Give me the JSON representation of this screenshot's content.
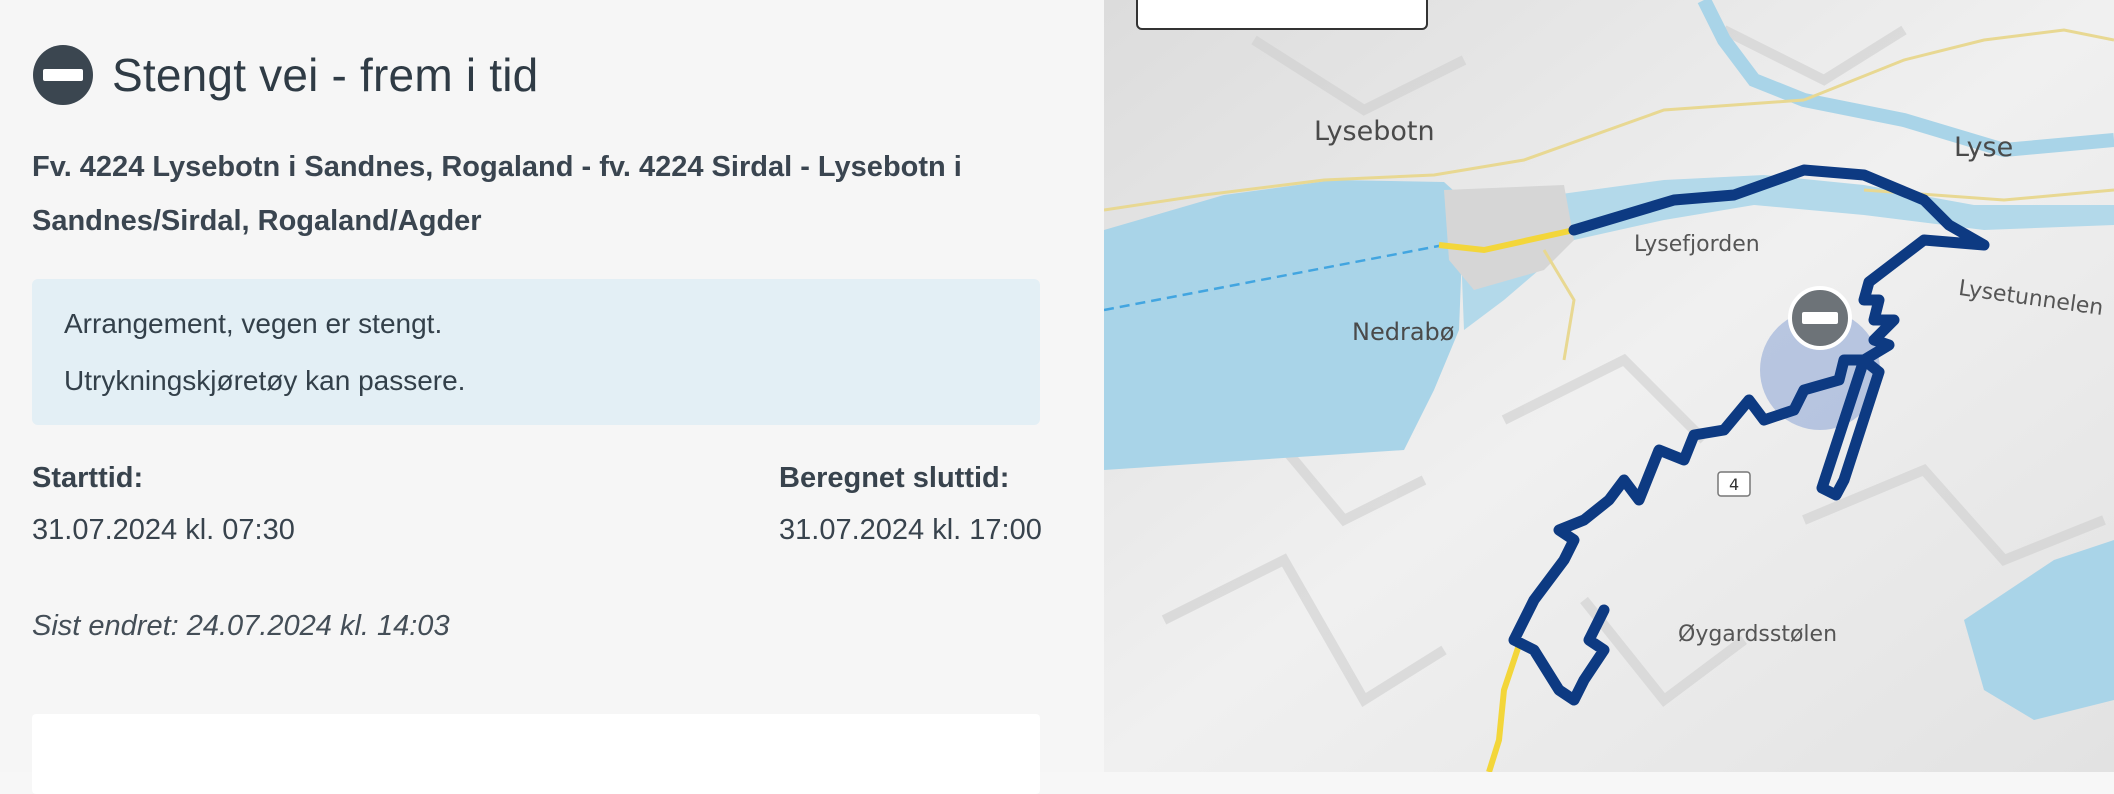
{
  "panel": {
    "title": "Stengt vei - frem i tid",
    "title_icon": "no-entry-icon",
    "road_line1": "Fv. 4224 Lysebotn i Sandnes, Rogaland - fv. 4224 Sirdal - Lysebotn i",
    "road_line2": "Sandnes/Sirdal, Rogaland/Agder",
    "info": {
      "line1": "Arrangement, vegen er stengt.",
      "line2": "Utrykningskjøretøy kan passere."
    },
    "start_label": "Starttid:",
    "start_value": "31.07.2024 kl. 07:30",
    "end_label": "Beregnet sluttid:",
    "end_value": "31.07.2024 kl. 17:00",
    "changed": "Sist endret: 24.07.2024 kl. 14:03"
  },
  "map": {
    "labels": {
      "lysebotn": "Lysebotn",
      "lyse": "Lyse",
      "lysefjorden": "Lysefjorden",
      "lysetunnelen": "Lysetunnelen",
      "nedrabo": "Nedrabø",
      "oygardsstolen": "Øygardsstølen",
      "road_number": "4"
    },
    "marker_icon": "no-entry-icon",
    "colors": {
      "route": "#0d3a82",
      "water": "#a9d4e8",
      "road_yellow": "#f3d63a",
      "marker": "#6d7378"
    }
  }
}
